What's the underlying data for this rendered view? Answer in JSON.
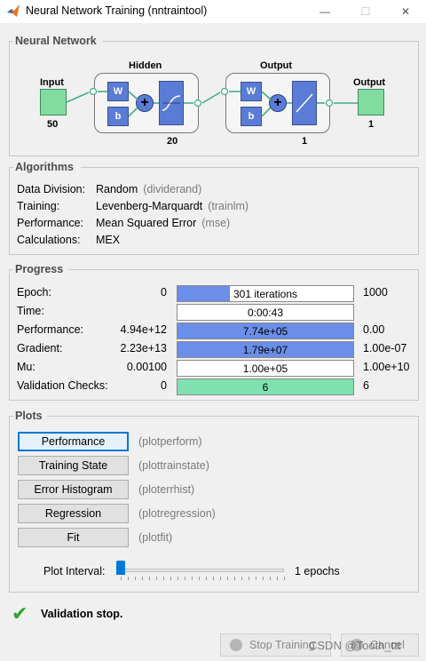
{
  "window": {
    "title": "Neural Network Training (nntraintool)",
    "min_glyph": "—",
    "max_glyph": "☐",
    "close_glyph": "✕"
  },
  "network": {
    "section_title": "Neural Network",
    "input_label": "Input",
    "input_size": "50",
    "hidden_label": "Hidden",
    "hidden_size": "20",
    "output_layer_label": "Output",
    "output_layer_size": "1",
    "output_label": "Output",
    "output_size": "1",
    "weight_label": "W",
    "bias_label": "b",
    "sum_glyph": "+"
  },
  "algorithms": {
    "section_title": "Algorithms",
    "rows": [
      {
        "label": "Data Division:",
        "value": "Random",
        "fn": "(dividerand)"
      },
      {
        "label": "Training:",
        "value": "Levenberg-Marquardt",
        "fn": "(trainlm)"
      },
      {
        "label": "Performance:",
        "value": "Mean Squared Error",
        "fn": "(mse)"
      },
      {
        "label": "Calculations:",
        "value": "MEX",
        "fn": ""
      }
    ]
  },
  "progress": {
    "section_title": "Progress",
    "rows": [
      {
        "label": "Epoch:",
        "min": "0",
        "text": "301 iterations",
        "max": "1000",
        "fill": 0.3,
        "color": "#6b8ee8"
      },
      {
        "label": "Time:",
        "min": "",
        "text": "0:00:43",
        "max": "",
        "fill": 0.0,
        "color": "#6b8ee8"
      },
      {
        "label": "Performance:",
        "min": "4.94e+12",
        "text": "7.74e+05",
        "max": "0.00",
        "fill": 1.0,
        "color": "#6b8ee8"
      },
      {
        "label": "Gradient:",
        "min": "2.23e+13",
        "text": "1.79e+07",
        "max": "1.00e-07",
        "fill": 1.0,
        "color": "#6b8ee8"
      },
      {
        "label": "Mu:",
        "min": "0.00100",
        "text": "1.00e+05",
        "max": "1.00e+10",
        "fill": 0.0,
        "color": "#6b8ee8"
      },
      {
        "label": "Validation Checks:",
        "min": "0",
        "text": "6",
        "max": "6",
        "fill": 1.0,
        "color": "#7fe0b0"
      }
    ]
  },
  "plots": {
    "section_title": "Plots",
    "buttons": [
      {
        "label": "Performance",
        "fn": "(plotperform)"
      },
      {
        "label": "Training State",
        "fn": "(plottrainstate)"
      },
      {
        "label": "Error Histogram",
        "fn": "(ploterrhist)"
      },
      {
        "label": "Regression",
        "fn": "(plotregression)"
      },
      {
        "label": "Fit",
        "fn": "(plotfit)"
      }
    ],
    "interval_label": "Plot Interval:",
    "interval_value": "1 epochs",
    "interval_position": 0.0
  },
  "status": {
    "message": "Validation stop.",
    "check_glyph": "✔"
  },
  "footer": {
    "stop_label": "Stop Training",
    "cancel_label": "Cancel",
    "watermark": "CSDN @Tooth_ttt"
  }
}
